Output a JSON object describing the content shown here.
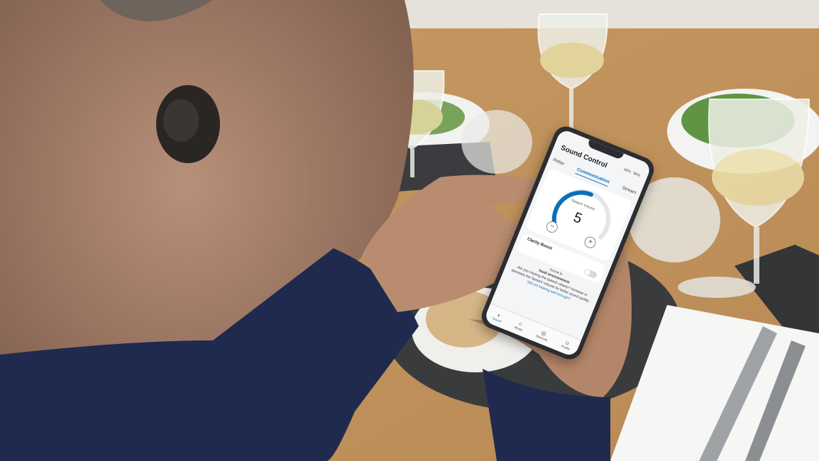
{
  "app": {
    "title": "Sound Control",
    "status": [
      "60%",
      "90%"
    ],
    "tabs": [
      {
        "label": "Relax",
        "active": false
      },
      {
        "label": "Communication",
        "active": true
      },
      {
        "label": "Stream",
        "active": false
      }
    ],
    "volume": {
      "label": "Speech Volume",
      "value": "5",
      "minus_icon": "minus-icon",
      "plus_icon": "plus-icon",
      "level_fraction": 0.5
    },
    "boost": {
      "label": "Clarity Boost",
      "enabled": false
    },
    "info": {
      "line1": "You're in",
      "environment": "loud environment",
      "body": "Are you hearing the speech clearly? Increase or decrease the Speech Volume for better sound quality.",
      "link": "Still not hearing well enough?"
    },
    "nav": [
      {
        "label": "Sound",
        "icon": "sound-icon",
        "active": true
      },
      {
        "label": "Music",
        "icon": "headphones-icon",
        "active": false
      },
      {
        "label": "Discover",
        "icon": "discover-icon",
        "active": false
      },
      {
        "label": "Profile",
        "icon": "profile-icon",
        "active": false
      }
    ],
    "accent_color": "#0a6fb8"
  }
}
